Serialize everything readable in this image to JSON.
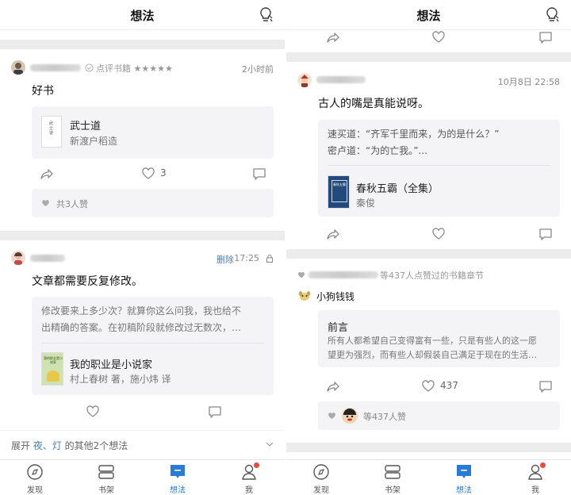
{
  "left": {
    "title": "想法",
    "post1": {
      "meta": "点评书籍 ★★★★★",
      "time": "2小时前",
      "text": "好书",
      "book_title": "武士道",
      "book_author": "新渡户稻造",
      "cover_text": "武士道",
      "like_count": "3",
      "likes_summary": "共3人赞"
    },
    "post2": {
      "delete_label": "删除",
      "time": "17:25",
      "text": "文章都需要反复修改。",
      "quote_line1": "修改要来上多少次？就算你这么问我，我也给不",
      "quote_line2": "出精确的答案。在初稿阶段就修改过无数次，…",
      "book_title": "我的职业是小说家",
      "book_author": "村上春树 著，施小炜 译",
      "cover_text": "我的职业是小说家"
    },
    "expand_prefix": "展开 ",
    "expand_names": "夜、灯",
    "expand_suffix": " 的其他2个想法"
  },
  "right": {
    "title": "想法",
    "post1": {
      "time": "10月8日 22:58",
      "text": "古人的嘴是真能说呀。",
      "quote_line1": "速买道：“齐军千里而来，为的是什么？”",
      "quote_line2": "密卢道：“为的亡我。”...",
      "book_title": "春秋五霸（全集）",
      "book_author": "秦俊",
      "cover_text": "春秋五霸"
    },
    "post2": {
      "meta": "等437人点赞过的书籍章节",
      "user": "小狗钱钱",
      "chapter_title": "前言",
      "chapter_line1": "所有人都希望自己变得富有一些，只是有些人的这一愿",
      "chapter_line2": "望更为强烈，而有些人却假装自己满足于现在的生活…",
      "like_count": "437",
      "likes_summary": "等437人赞"
    }
  },
  "tabs": [
    {
      "label": "发现",
      "icon": "compass-icon"
    },
    {
      "label": "书架",
      "icon": "bookshelf-icon"
    },
    {
      "label": "想法",
      "icon": "thought-icon"
    },
    {
      "label": "我",
      "icon": "person-icon"
    }
  ],
  "colors": {
    "accent": "#2a7bd6",
    "badge": "#e94b3c",
    "link": "#4a7fb5"
  }
}
